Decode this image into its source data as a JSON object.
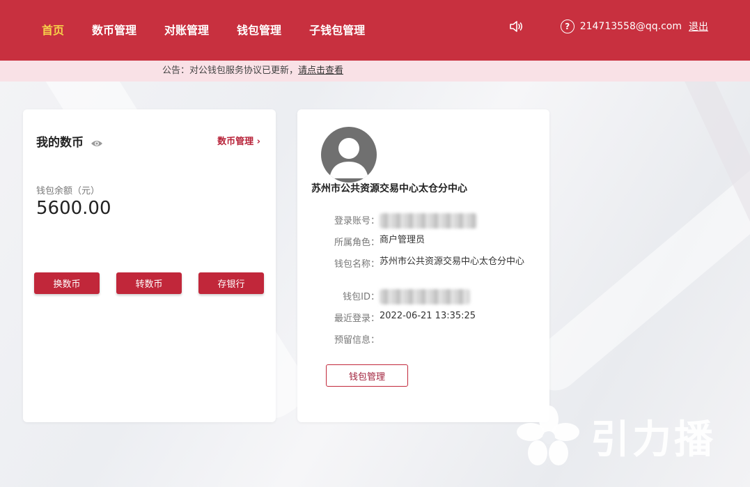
{
  "nav": {
    "items": [
      {
        "label": "首页",
        "active": true
      },
      {
        "label": "数币管理",
        "active": false
      },
      {
        "label": "对账管理",
        "active": false
      },
      {
        "label": "钱包管理",
        "active": false
      },
      {
        "label": "子钱包管理",
        "active": false
      }
    ],
    "email": "214713558@qq.com",
    "logout": "退出",
    "help_glyph": "?"
  },
  "notice": {
    "text": "公告：对公钱包服务协议已更新，",
    "link": "请点击查看"
  },
  "wallet_card": {
    "title": "我的数币",
    "manage_link": "数币管理 ›",
    "balance_label": "钱包余额（元）",
    "balance_value": "5600.00",
    "buttons": [
      "换数币",
      "转数币",
      "存银行"
    ]
  },
  "profile_card": {
    "org_name": "苏州市公共资源交易中心太仓分中心",
    "rows": [
      {
        "label": "登录账号：",
        "value": ""
      },
      {
        "label": "所属角色：",
        "value": "商户管理员"
      },
      {
        "label": "钱包名称：",
        "value": "苏州市公共资源交易中心太仓分中心"
      },
      {
        "label": "钱包ID：",
        "value": ""
      },
      {
        "label": "最近登录：",
        "value": "2022-06-21 13:35:25"
      },
      {
        "label": "预留信息：",
        "value": ""
      }
    ],
    "manage_button": "钱包管理"
  },
  "watermark": {
    "text": "引力播"
  },
  "colors": {
    "brand_red": "#c8303f",
    "nav_active": "#f7d24a",
    "notice_bg": "#f9e1e6"
  }
}
